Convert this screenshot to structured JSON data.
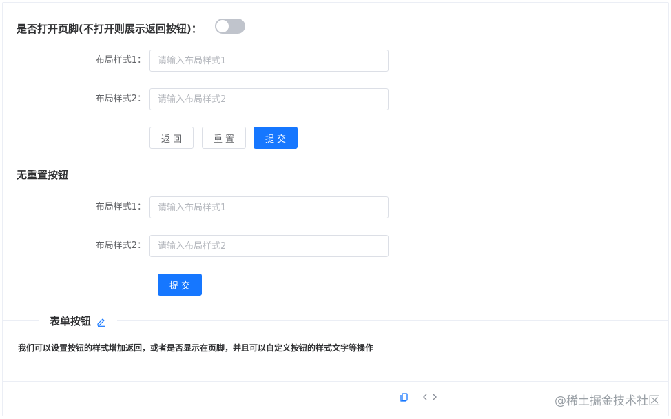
{
  "section1": {
    "title": "是否打开页脚(不打开则展示返回按钮)：",
    "switch_on": false,
    "field1_label": "布局样式1：",
    "field1_placeholder": "请输入布局样式1",
    "field2_label": "布局样式2：",
    "field2_placeholder": "请输入布局样式2",
    "back_label": "返回",
    "reset_label": "重置",
    "submit_label": "提交"
  },
  "section2": {
    "title": "无重置按钮",
    "field1_label": "布局样式1：",
    "field1_placeholder": "请输入布局样式1",
    "field2_label": "布局样式2：",
    "field2_placeholder": "请输入布局样式2",
    "submit_label": "提交"
  },
  "demo": {
    "title": "表单按钮",
    "description": "我们可以设置按钮的样式增加返回，或者是否显示在页脚，并且可以自定义按钮的样式文字等操作"
  },
  "footer": {
    "icons": [
      "copy-icon",
      "code-icon"
    ],
    "watermark": "@稀土掘金技术社区"
  },
  "colors": {
    "primary": "#1677ff",
    "switch_off": "#c0c4cc",
    "border": "#dcdfe6"
  }
}
